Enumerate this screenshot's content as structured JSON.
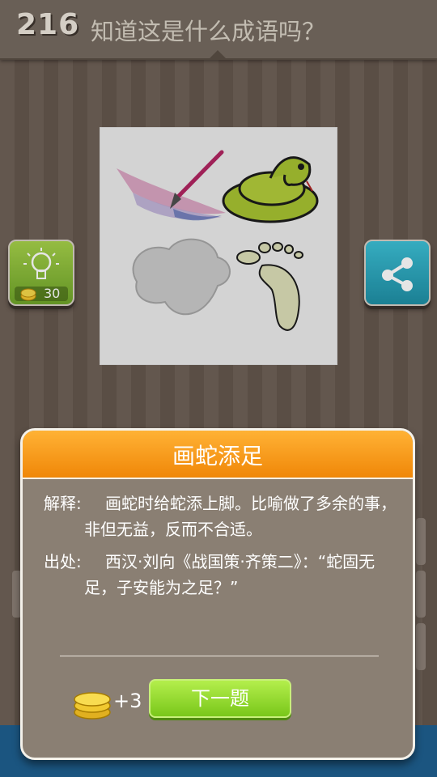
{
  "header": {
    "level": "216",
    "question": "知道这是什么成语吗？"
  },
  "hint": {
    "cost": "30",
    "icon": "lightbulb-icon"
  },
  "share": {
    "icon": "share-icon"
  },
  "puzzle": {
    "images": [
      "paintbrush-stroke",
      "snake",
      "cloud",
      "footprint"
    ]
  },
  "dialog": {
    "title": "画蛇添足",
    "explanation_label": "解释:",
    "explanation": "画蛇时给蛇添上脚。比喻做了多余的事，非但无益，反而不合适。",
    "source_label": "出处:",
    "source": "西汉·刘向《战国策·齐策二》：“蛇固无足，子安能为之足？”",
    "reward": "+3",
    "next_label": "下一题"
  },
  "colors": {
    "header_orange": "#f08708",
    "button_green": "#79c71a",
    "hint_green": "#6fa52a",
    "share_blue": "#1f8fa5"
  }
}
